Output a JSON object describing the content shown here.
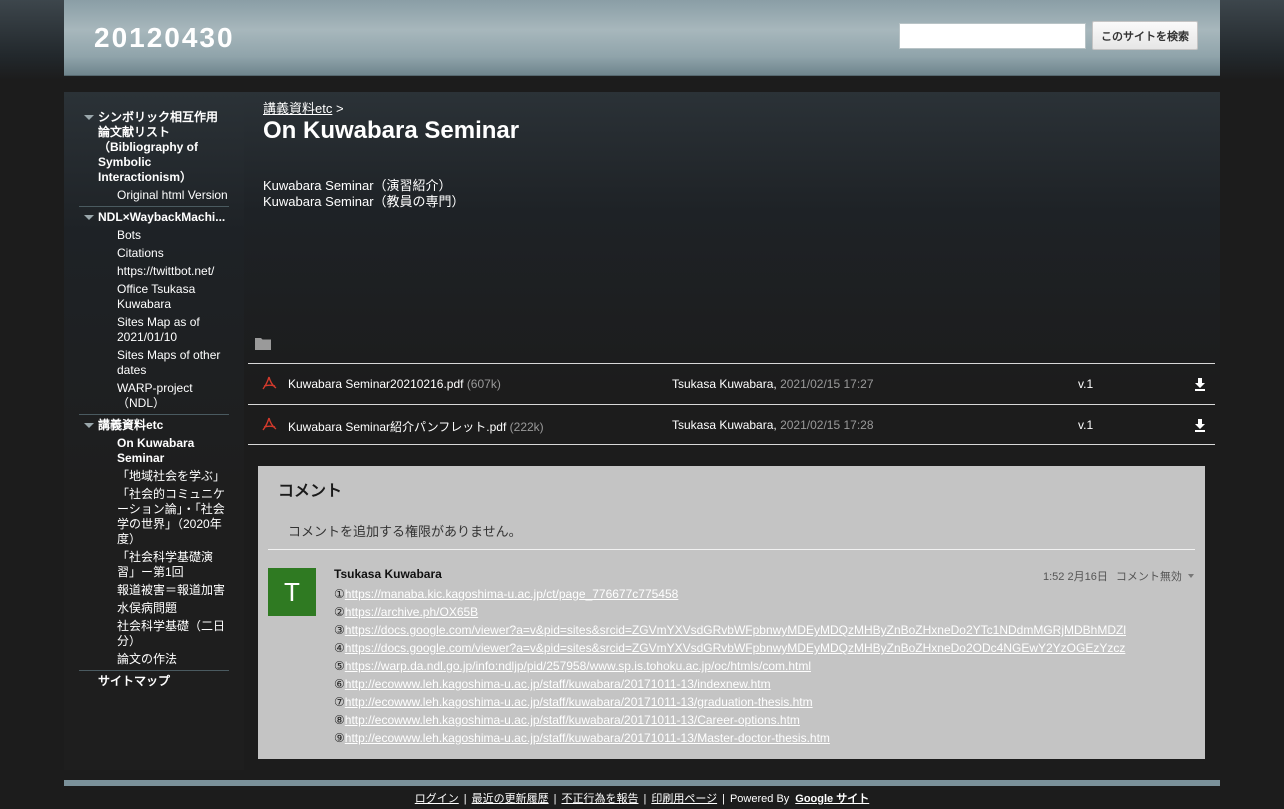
{
  "site": {
    "title": "20120430"
  },
  "search": {
    "placeholder": "",
    "button_label": "このサイトを検索"
  },
  "sidebar": {
    "groups": [
      {
        "label": "シンボリック相互作用論文献リスト（Bibliography of Symbolic Interactionism）",
        "children": [
          "Original html Version"
        ]
      },
      {
        "label": "NDL×WaybackMachi...",
        "children": [
          "Bots",
          "Citations",
          "https://twittbot.net/",
          "Office Tsukasa Kuwabara",
          "Sites Map as of 2021/01/10",
          "Sites Maps of other dates",
          "WARP-project（NDL）"
        ]
      },
      {
        "label": "講義資料etc",
        "children": [
          "On Kuwabara Seminar",
          "「地域社会を学ぶ」",
          "「社会的コミュニケーション論」・「社会学の世界」（2020年度）",
          "「社会科学基礎演習」ー第1回",
          "報道被害＝報道加害",
          "水俣病問題",
          "社会科学基礎（二日分）",
          "論文の作法"
        ]
      }
    ],
    "sitemap": "サイトマップ"
  },
  "breadcrumb": {
    "parent": "講義資料etc",
    "separator": ">"
  },
  "page": {
    "title": "On Kuwabara Seminar",
    "lines": [
      "Kuwabara Seminar（演習紹介）",
      "Kuwabara Seminar（教員の専門）"
    ]
  },
  "files": [
    {
      "name": "Kuwabara Seminar20210216.pdf",
      "size": "(607k)",
      "author": "Tsukasa Kuwabara,",
      "date": "2021/02/15 17:27",
      "version": "v.1"
    },
    {
      "name": "Kuwabara Seminar紹介パンフレット.pdf",
      "size": "(222k)",
      "author": "Tsukasa Kuwabara,",
      "date": "2021/02/15 17:28",
      "version": "v.1"
    }
  ],
  "comments": {
    "heading": "コメント",
    "no_permission": "コメントを追加する権限がありません。",
    "avatar_letter": "T",
    "author": "Tsukasa Kuwabara",
    "time": "1:52 2月16日",
    "disable": "コメント無効",
    "links": [
      {
        "num": "①",
        "url": "https://manaba.kic.kagoshima-u.ac.jp/ct/page_776677c775458"
      },
      {
        "num": "②",
        "url": "https://archive.ph/OX65B"
      },
      {
        "num": "③",
        "url": "https://docs.google.com/viewer?a=v&pid=sites&srcid=ZGVmYXVsdGRvbWFpbnwyMDEyMDQzMHByZnBoZHxneDo2YTc1NDdmMGRjMDBhMDZl"
      },
      {
        "num": "④",
        "url": "https://docs.google.com/viewer?a=v&pid=sites&srcid=ZGVmYXVsdGRvbWFpbnwyMDEyMDQzMHByZnBoZHxneDo2ODc4NGEwY2YzOGEzYzcz"
      },
      {
        "num": "⑤",
        "url": "https://warp.da.ndl.go.jp/info:ndljp/pid/257958/www.sp.is.tohoku.ac.jp/oc/htmls/com.html"
      },
      {
        "num": "⑥",
        "url": "http://ecowww.leh.kagoshima-u.ac.jp/staff/kuwabara/20171011-13/indexnew.htm"
      },
      {
        "num": "⑦",
        "url": "http://ecowww.leh.kagoshima-u.ac.jp/staff/kuwabara/20171011-13/graduation-thesis.htm"
      },
      {
        "num": "⑧",
        "url": "http://ecowww.leh.kagoshima-u.ac.jp/staff/kuwabara/20171011-13/Career-options.htm"
      },
      {
        "num": "⑨",
        "url": "http://ecowww.leh.kagoshima-u.ac.jp/staff/kuwabara/20171011-13/Master-doctor-thesis.htm"
      }
    ]
  },
  "footer": {
    "login": "ログイン",
    "recent": "最近の更新履歴",
    "abuse": "不正行為を報告",
    "print": "印刷用ページ",
    "powered": "Powered By",
    "google_sites": "Google サイト",
    "pipe": "|"
  }
}
